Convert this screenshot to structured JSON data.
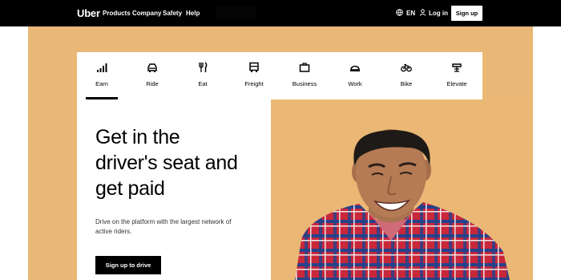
{
  "brand": {
    "logo": "Uber"
  },
  "nav": {
    "items": [
      "Products",
      "Company",
      "Safety",
      "Help"
    ]
  },
  "header_right": {
    "language": "EN",
    "login": "Log in",
    "signup": "Sign up"
  },
  "tabs": [
    {
      "label": "Earn",
      "icon": "bar-chart-icon"
    },
    {
      "label": "Ride",
      "icon": "car-icon"
    },
    {
      "label": "Eat",
      "icon": "utensils-icon"
    },
    {
      "label": "Freight",
      "icon": "truck-icon"
    },
    {
      "label": "Business",
      "icon": "briefcase-icon"
    },
    {
      "label": "Work",
      "icon": "helmet-icon"
    },
    {
      "label": "Bike",
      "icon": "bike-icon"
    },
    {
      "label": "Elevate",
      "icon": "elevate-icon"
    }
  ],
  "active_tab": "Earn",
  "hero": {
    "headline_lines": [
      "Get in the",
      "driver's seat and",
      "get paid"
    ],
    "description_lines": [
      "Drive on the platform with the largest network of",
      "active riders."
    ],
    "cta": "Sign up to drive"
  },
  "colors": {
    "hero_background": "#e9b876",
    "topbar": "#000000",
    "shirt_red": "#c8283a",
    "shirt_blue": "#27418a"
  }
}
